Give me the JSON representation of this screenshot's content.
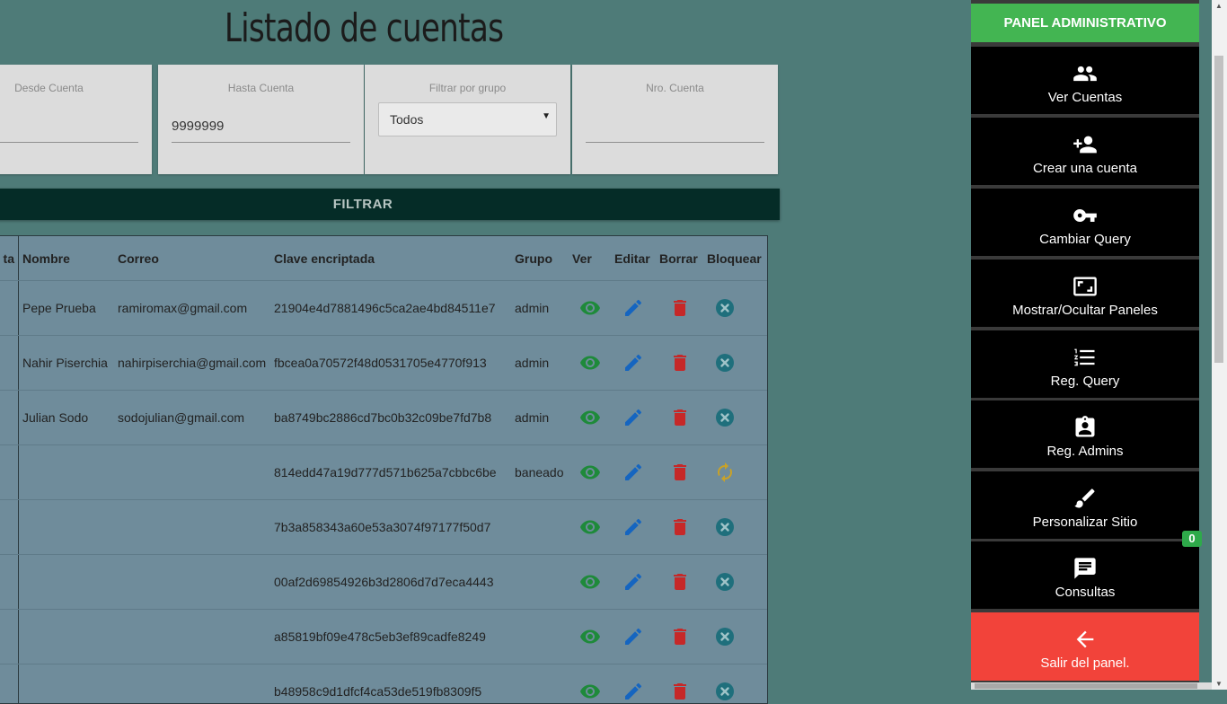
{
  "page": {
    "title": "Listado de cuentas"
  },
  "filters": {
    "desde": {
      "label": "Desde Cuenta",
      "value": ""
    },
    "hasta": {
      "label": "Hasta Cuenta",
      "value": "9999999"
    },
    "grupo": {
      "label": "Filtrar por grupo",
      "selected": "Todos"
    },
    "nro": {
      "label": "Nro. Cuenta",
      "value": ""
    },
    "button": "FILTRAR"
  },
  "table": {
    "headers": [
      "ta",
      "Nombre",
      "Correo",
      "Clave encriptada",
      "Grupo",
      "Ver",
      "Editar",
      "Borrar",
      "Bloquear"
    ],
    "rows": [
      {
        "nombre": "Pepe Prueba",
        "correo": "ramiromax@gmail.com",
        "clave": "21904e4d7881496c5ca2ae4bd84511e7",
        "grupo": "admin",
        "bloqueo": "x-circle-icon"
      },
      {
        "nombre": "Nahir Piserchia",
        "correo": "nahirpiserchia@gmail.com",
        "clave": "fbcea0a70572f48d0531705e4770f913",
        "grupo": "admin",
        "bloqueo": "x-circle-icon"
      },
      {
        "nombre": "Julian Sodo",
        "correo": "sodojulian@gmail.com",
        "clave": "ba8749bc2886cd7bc0b32c09be7fd7b8",
        "grupo": "admin",
        "bloqueo": "x-circle-icon"
      },
      {
        "nombre": "",
        "correo": "",
        "clave": "814edd47a19d777d571b625a7cbbc6be",
        "grupo": "baneado",
        "bloqueo": "refresh-icon"
      },
      {
        "nombre": "",
        "correo": "",
        "clave": "7b3a858343a60e53a3074f97177f50d7",
        "grupo": "",
        "bloqueo": "x-circle-icon"
      },
      {
        "nombre": "",
        "correo": "",
        "clave": "00af2d69854926b3d2806d7d7eca4443",
        "grupo": "",
        "bloqueo": "x-circle-icon"
      },
      {
        "nombre": "",
        "correo": "",
        "clave": "a85819bf09e478c5eb3ef89cadfe8249",
        "grupo": "",
        "bloqueo": "x-circle-icon"
      },
      {
        "nombre": "",
        "correo": "",
        "clave": "b48958c9d1dfcf4ca53de519fb8309f5",
        "grupo": "",
        "bloqueo": "x-circle-icon"
      }
    ]
  },
  "sidebar": {
    "header": "PANEL ADMINISTRATIVO",
    "items": [
      {
        "label": "Ver Cuentas",
        "icon": "people-icon"
      },
      {
        "label": "Crear una cuenta",
        "icon": "person-add-icon"
      },
      {
        "label": "Cambiar Query",
        "icon": "key-icon"
      },
      {
        "label": "Mostrar/Ocultar Paneles",
        "icon": "aspect-ratio-icon"
      },
      {
        "label": "Reg. Query",
        "icon": "list-icon"
      },
      {
        "label": "Reg. Admins",
        "icon": "badge-icon"
      },
      {
        "label": "Personalizar Sitio",
        "icon": "brush-icon"
      },
      {
        "label": "Consultas",
        "icon": "chat-icon"
      }
    ],
    "exit": {
      "label": "Salir del panel.",
      "icon": "arrow-left-icon"
    },
    "badge": "0"
  },
  "colors": {
    "background": "#4e7b78",
    "header_green": "#43b552",
    "exit_red": "#f2433a",
    "view_green": "#1e8a3a",
    "edit_blue": "#1565c0",
    "delete_red": "#c62828",
    "block_teal": "#1f6f7c",
    "unblock_gold": "#c9a227"
  }
}
